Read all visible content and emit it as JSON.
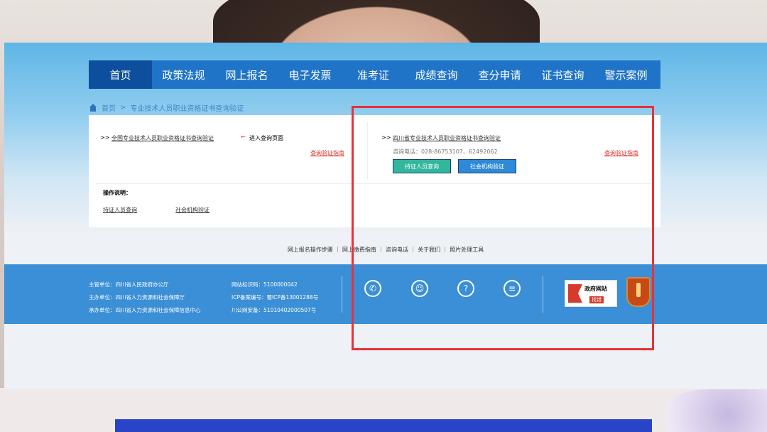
{
  "nav": {
    "items": [
      "首页",
      "政策法规",
      "网上报名",
      "电子发票",
      "准考证",
      "成绩查询",
      "查分申请",
      "证书查询",
      "警示案例"
    ]
  },
  "breadcrumb": {
    "home": "首页",
    "sep": ">",
    "current": "专业技术人员职业资格证书查询验证"
  },
  "left_panel": {
    "prefix": ">>",
    "link": "全国专业技术人员职业资格证书查询验证",
    "arrow": "←",
    "enter": "进入查询页面",
    "guide": "查询验证指南"
  },
  "right_panel": {
    "prefix": ">>",
    "link": "四川省专业技术人员职业资格证书查询验证",
    "phone": "咨询电话：028-86753107、62492062",
    "guide": "查询验证指南",
    "btn_holder": "持证人员查询",
    "btn_org": "社会机构验证"
  },
  "ops": {
    "title": "操作说明：",
    "link1": "持证人员查询",
    "link2": "社会机构验证"
  },
  "footer_links": [
    "网上报名操作步骤",
    "网上缴费指南",
    "咨询电话",
    "关于我们",
    "照片处理工具"
  ],
  "footer": {
    "col1": [
      "主管单位：四川省人民政府办公厅",
      "主办单位：四川省人力资源和社会保障厅",
      "承办单位：四川省人力资源和社会保障信息中心"
    ],
    "col2": [
      "网站标识码：5100000042",
      "ICP备案编号：蜀ICP备13001288号",
      "川公网安备：51010402000507号"
    ],
    "gov_badge_line1": "政府网站",
    "gov_badge_line2": "找错"
  },
  "icons": [
    "phone-icon",
    "user-icon",
    "question-icon",
    "document-icon"
  ],
  "colors": {
    "nav": "#1f74c7",
    "nav_active": "#0d4f9c",
    "footer": "#3b8fd6",
    "highlight": "#e8313a"
  }
}
